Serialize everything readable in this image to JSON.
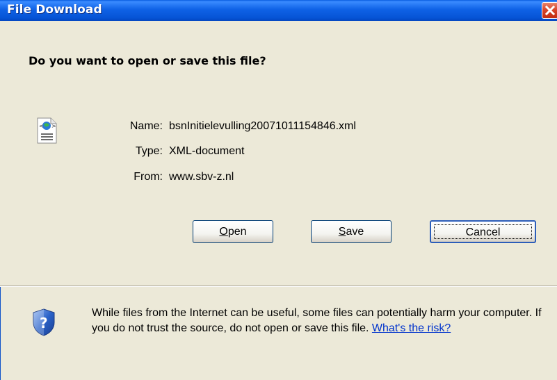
{
  "window": {
    "title": "File Download"
  },
  "dialog": {
    "question": "Do you want to open or save this file?",
    "name_label": "Name:",
    "name_value": "bsnInitielevulling20071011154846.xml",
    "type_label": "Type:",
    "type_value": "XML-document",
    "from_label": "From:",
    "from_value": "www.sbv-z.nl",
    "buttons": {
      "open_prefix": "",
      "open_mnemonic": "O",
      "open_rest": "pen",
      "save_prefix": "",
      "save_mnemonic": "S",
      "save_rest": "ave",
      "cancel": "Cancel"
    },
    "warning": {
      "text": "While files from the Internet can be useful, some files can potentially harm your computer. If you do not trust the source, do not open or save this file.",
      "link": "What's the risk?"
    }
  },
  "icons": {
    "file": "xml-file-icon",
    "shield": "security-shield-icon",
    "close": "close-icon"
  }
}
